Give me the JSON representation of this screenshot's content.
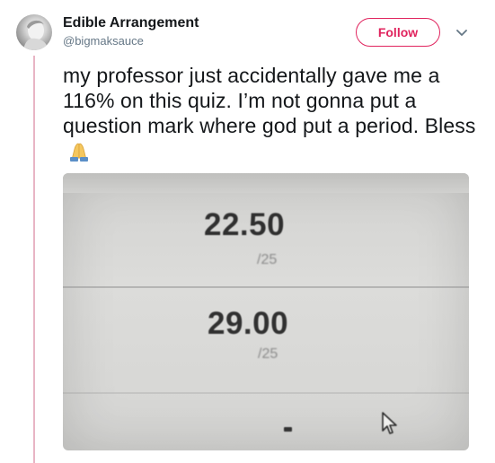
{
  "user": {
    "display_name": "Edible Arrangement",
    "handle": "@bigmaksauce"
  },
  "follow_button": {
    "label": "Follow"
  },
  "tweet": {
    "text": "my professor just accidentally gave me a 116% on this quiz. I’m not gonna put a question mark where god put a period. Bless",
    "emoji": "folded-hands-emoji"
  },
  "media": {
    "scores": [
      {
        "value": "22.50",
        "out_of": "/25"
      },
      {
        "value": "29.00",
        "out_of": "/25"
      }
    ]
  },
  "colors": {
    "accent": "#e0245e",
    "thread_line": "#e8b5c5",
    "text": "#14171a",
    "secondary_text": "#657786"
  },
  "icons": [
    "avatar-image",
    "chevron-down-icon",
    "folded-hands-emoji",
    "mouse-cursor-icon"
  ]
}
